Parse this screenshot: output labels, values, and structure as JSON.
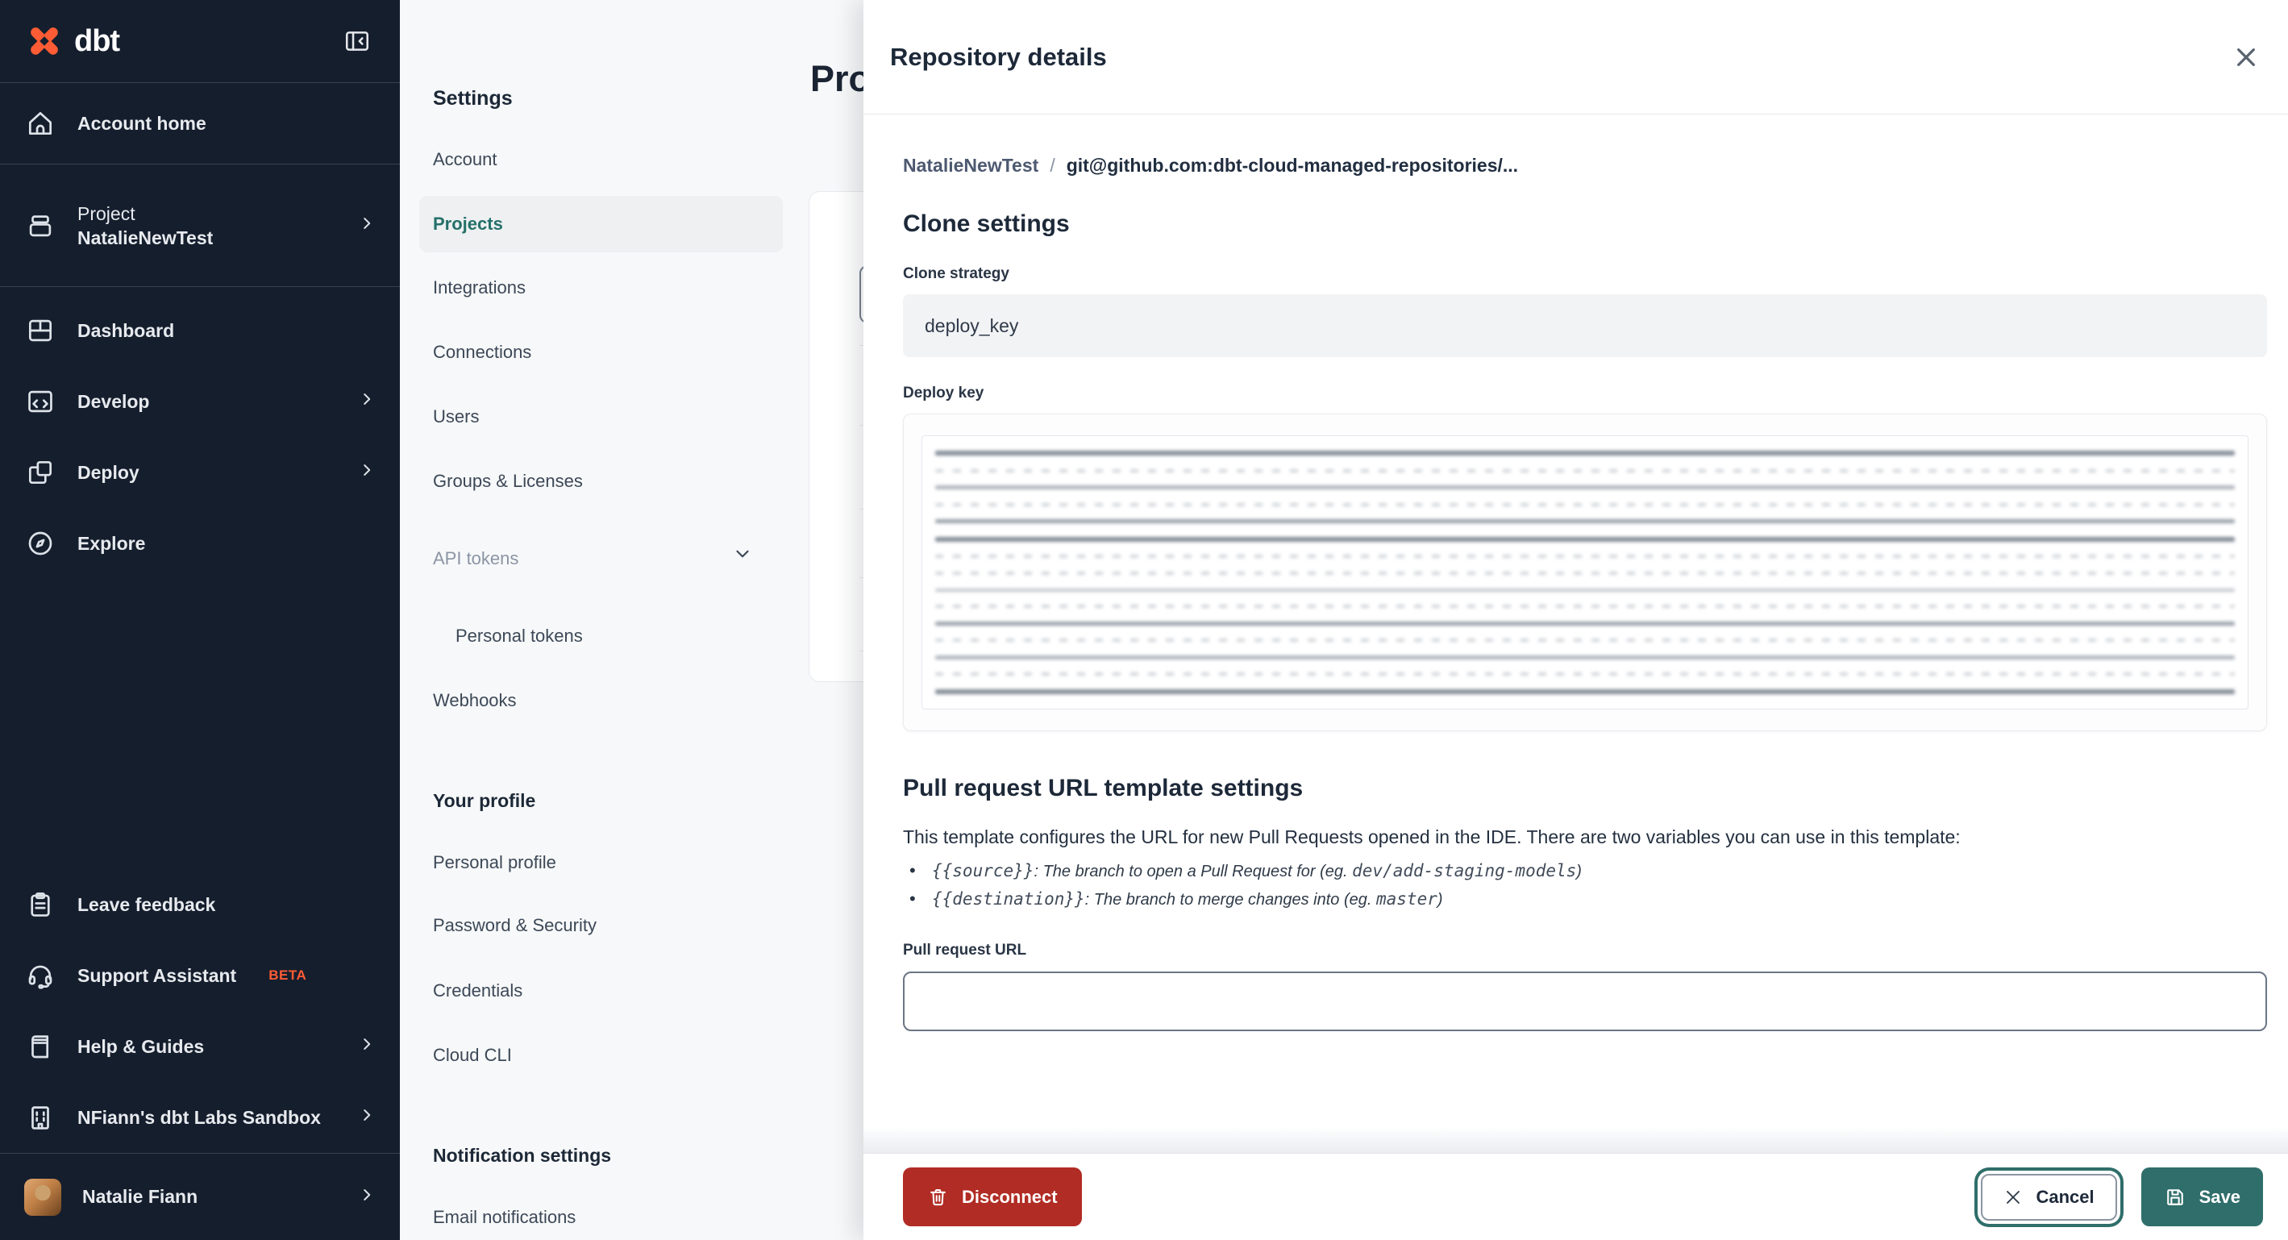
{
  "brand": {
    "name": "dbt"
  },
  "colors": {
    "accent_teal": "#2f6e6a",
    "danger_red": "#b12c24",
    "brand_orange": "#ff5c35",
    "sidebar_navy": "#151e2d"
  },
  "sidebar": {
    "account_home": "Account home",
    "project_label": "Project",
    "project_name": "NatalieNewTest",
    "dashboard": "Dashboard",
    "develop": "Develop",
    "deploy": "Deploy",
    "explore": "Explore",
    "leave_feedback": "Leave feedback",
    "support_assistant": "Support Assistant",
    "beta": "BETA",
    "help_guides": "Help & Guides",
    "org": "NFiann's dbt Labs Sandbox",
    "user": "Natalie Fiann"
  },
  "settings_nav": {
    "title": "Settings",
    "account": "Account",
    "projects": "Projects",
    "integrations": "Integrations",
    "connections": "Connections",
    "users": "Users",
    "groups": "Groups & Licenses",
    "api_tokens": "API tokens",
    "personal_tokens": "Personal tokens",
    "webhooks": "Webhooks",
    "profile_heading": "Your profile",
    "personal_profile": "Personal profile",
    "password_security": "Password & Security",
    "credentials": "Credentials",
    "cloud_cli": "Cloud CLI",
    "notifications_heading": "Notification settings",
    "email_notifications": "Email notifications"
  },
  "main": {
    "page_title": "Projects"
  },
  "drawer": {
    "title": "Repository details",
    "breadcrumb_project": "NatalieNewTest",
    "breadcrumb_separator": "/",
    "breadcrumb_repo": "git@github.com:dbt-cloud-managed-repositories/...",
    "clone_heading": "Clone settings",
    "clone_strategy_label": "Clone strategy",
    "clone_strategy_value": "deploy_key",
    "deploy_key_label": "Deploy key",
    "pr_heading": "Pull request URL template settings",
    "pr_description": "This template configures the URL for new Pull Requests opened in the IDE. There are two variables you can use in this template:",
    "bullets": [
      {
        "code": "{{source}}",
        "colon": ": ",
        "desc": "The branch to open a Pull Request for (eg. ",
        "example": "dev/add-staging-models",
        "close": ")"
      },
      {
        "code": "{{destination}}",
        "colon": ": ",
        "desc": "The branch to merge changes into (eg. ",
        "example": "master",
        "close": ")"
      }
    ],
    "pr_url_label": "Pull request URL",
    "pr_url_value": "",
    "disconnect": "Disconnect",
    "cancel": "Cancel",
    "save": "Save"
  }
}
